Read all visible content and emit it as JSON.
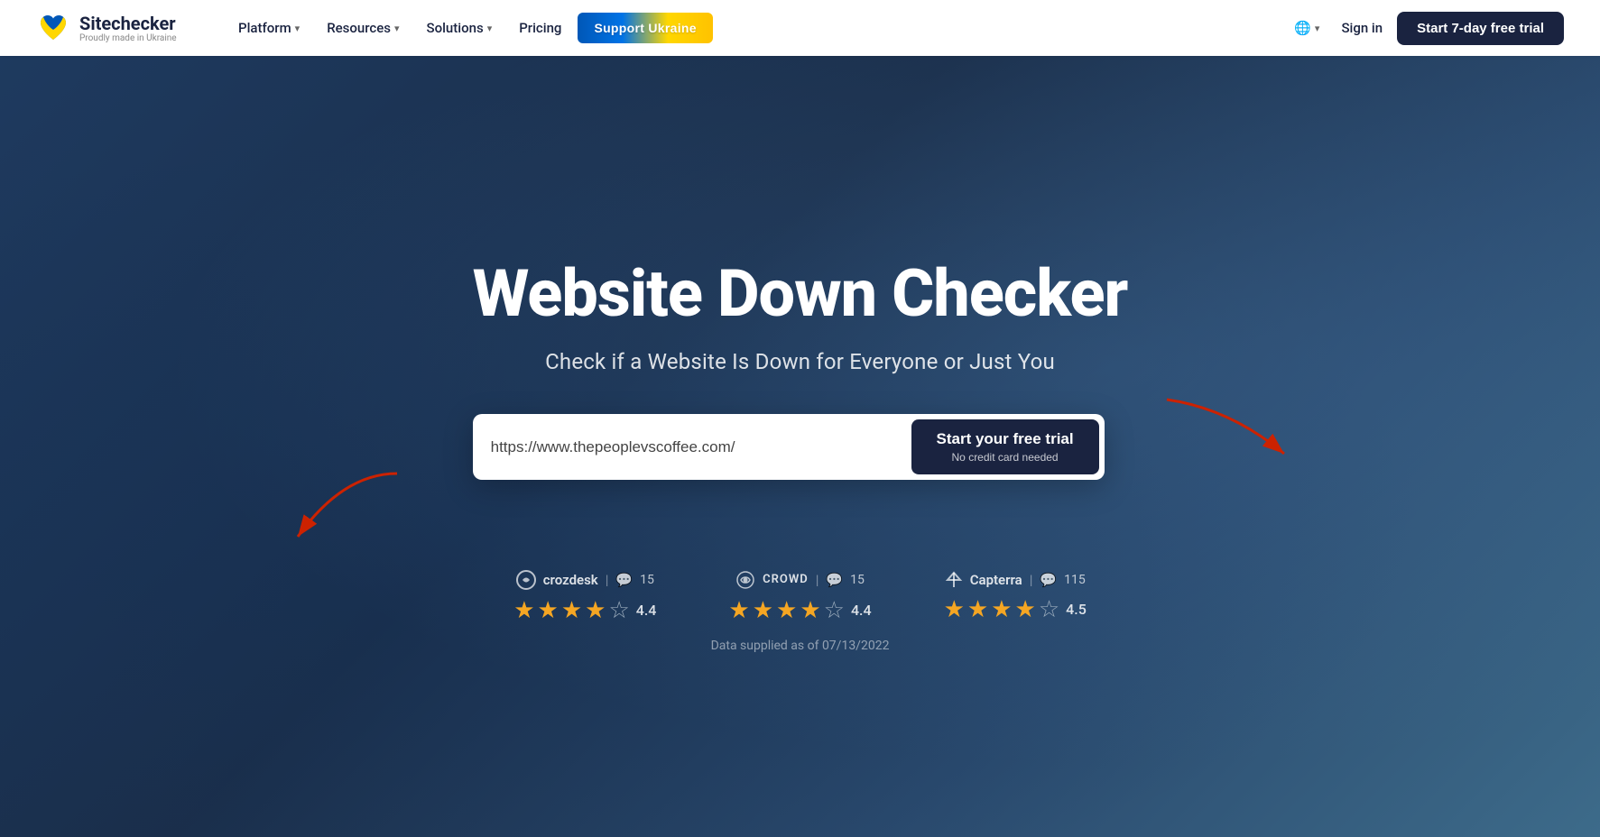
{
  "navbar": {
    "logo_name": "Sitechecker",
    "logo_tagline": "Proudly made in Ukraine",
    "nav_platform": "Platform",
    "nav_resources": "Resources",
    "nav_solutions": "Solutions",
    "nav_pricing": "Pricing",
    "support_btn": "Support Ukraine",
    "signin": "Sign in",
    "trial_btn": "Start 7-day free trial"
  },
  "hero": {
    "title": "Website Down Checker",
    "subtitle": "Check if a Website Is Down for Everyone or Just You",
    "input_value": "https://www.thepeoplevscoffee.com/",
    "input_placeholder": "https://www.thepeoplevscoffee.com/",
    "cta_main": "Start your free trial",
    "cta_sub": "No credit card needed"
  },
  "ratings": [
    {
      "platform": "crozdesk",
      "name": "crozdesk",
      "count": "15",
      "score": "4.4",
      "full_stars": 4,
      "half_star": true,
      "empty_stars": 1
    },
    {
      "platform": "crowd",
      "name": "CROWD",
      "count": "15",
      "score": "4.4",
      "full_stars": 4,
      "half_star": true,
      "empty_stars": 1
    },
    {
      "platform": "capterra",
      "name": "Capterra",
      "count": "115",
      "score": "4.5",
      "full_stars": 4,
      "half_star": true,
      "empty_stars": 1
    }
  ],
  "data_note": "Data supplied as of 07/13/2022",
  "icons": {
    "chat_icon": "💬",
    "globe_icon": "🌐"
  }
}
